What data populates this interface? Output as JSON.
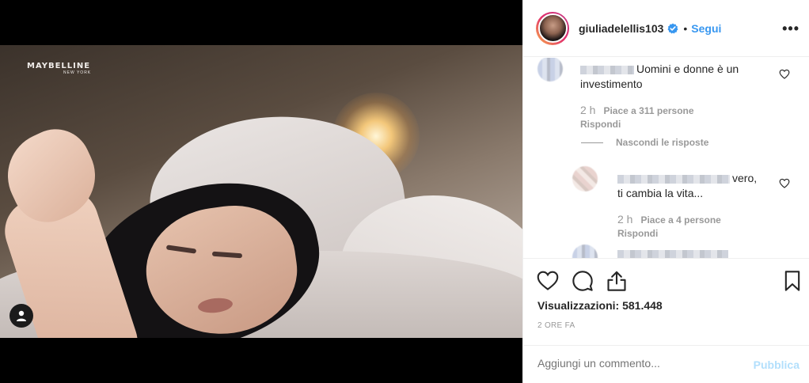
{
  "post": {
    "username": "giuliadelellis103",
    "follow_label": "Segui",
    "separator": "•",
    "more_label": "•••",
    "verified_icon": "verified-badge-icon"
  },
  "media": {
    "brand": "MAYBELLINE",
    "brand_sub": "NEW YORK",
    "tag_icon": "user-tag-icon"
  },
  "comments": [
    {
      "text": "Uomini e donne è un investimento",
      "time": "2 h",
      "likes": "Piace a 311 persone",
      "reply_label": "Rispondi",
      "hide_replies": "Nascondi le risposte"
    },
    {
      "text_line1": "vero,",
      "text_line2": "ti cambia la vita...",
      "time": "2 h",
      "likes": "Piace a 4 persone",
      "reply_label": "Rispondi"
    }
  ],
  "actions": {
    "views_label": "Visualizzazioni: 581.448",
    "date": "2 ORE FA"
  },
  "comment_form": {
    "placeholder": "Aggiungi un commento...",
    "publish_label": "Pubblica"
  },
  "colors": {
    "accent": "#3897f0",
    "publish_disabled": "#b2dffc",
    "text": "#262626",
    "muted": "#999999"
  }
}
